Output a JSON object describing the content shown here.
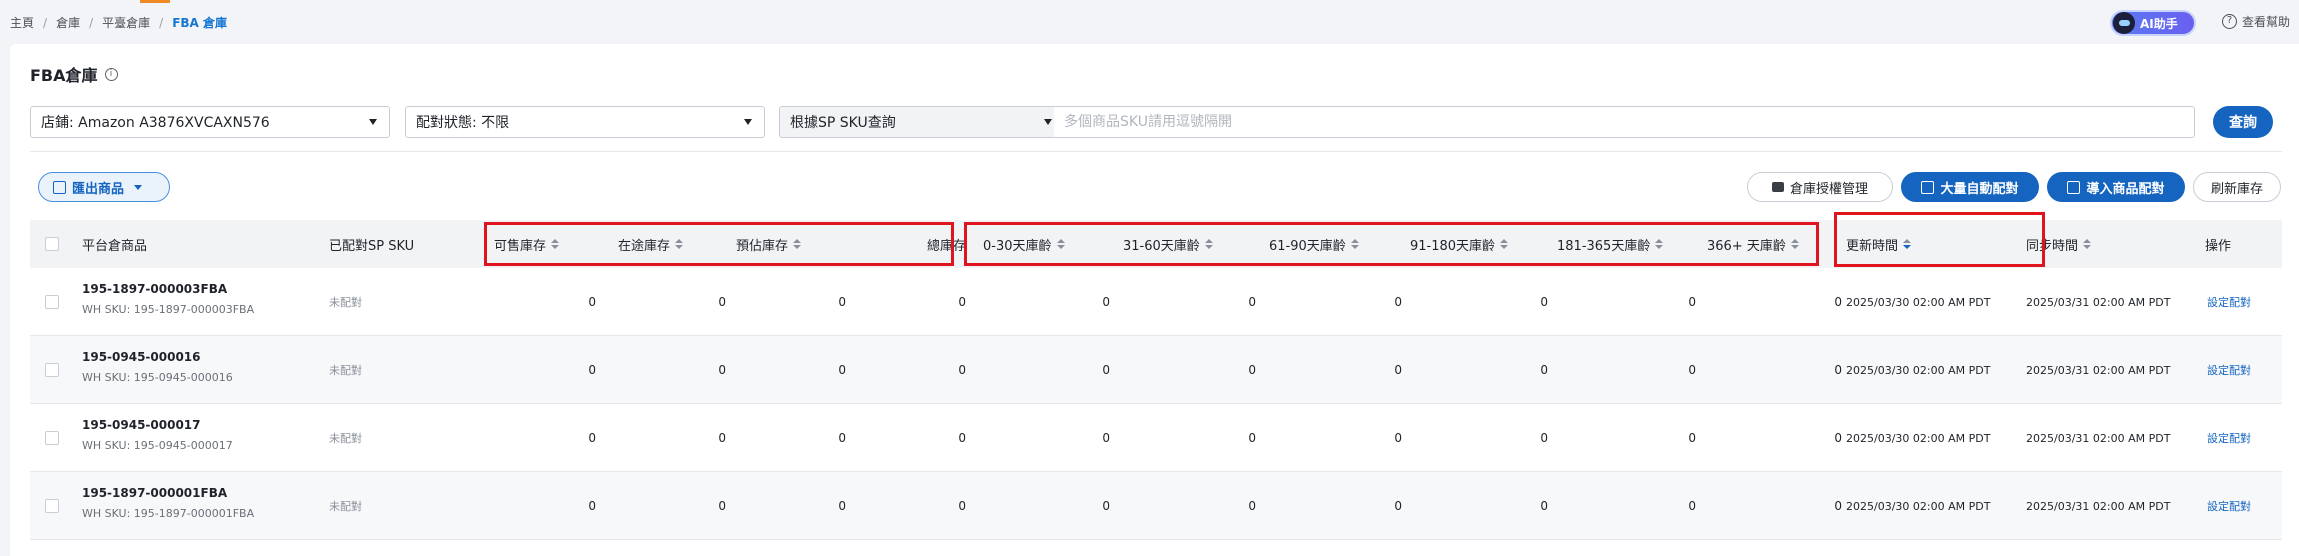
{
  "breadcrumb": [
    "主頁",
    "倉庫",
    "平臺倉庫",
    "FBA 倉庫"
  ],
  "header": {
    "ai_label": "AI助手",
    "help_label": "查看幫助"
  },
  "page": {
    "title": "FBA倉庫"
  },
  "filters": {
    "store": "店鋪: Amazon A3876XVCAXN576",
    "match_status": "配對狀態: 不限",
    "query_by": "根據SP SKU查詢",
    "search_placeholder": "多個商品SKU請用逗號隔開",
    "query_button": "查詢"
  },
  "toolbar": {
    "export": "匯出商品",
    "auth": "倉庫授權管理",
    "bulk_auto": "大量自動配對",
    "import": "導入商品配對",
    "refresh": "刷新庫存"
  },
  "columns": {
    "product": "平台倉商品",
    "matched_sku": "已配對SP SKU",
    "available": "可售庫存",
    "in_transit": "在途庫存",
    "reserved": "預佔庫存",
    "total": "總庫存",
    "age_0_30": "0-30天庫齡",
    "age_31_60": "31-60天庫齡",
    "age_61_90": "61-90天庫齡",
    "age_91_180": "91-180天庫齡",
    "age_181_365": "181-365天庫齡",
    "age_366": "366+ 天庫齡",
    "updated": "更新時間",
    "synced": "同步時間",
    "actions": "操作"
  },
  "rows": [
    {
      "name": "195-1897-000003FBA",
      "wh_sku": "WH SKU: 195-1897-000003FBA",
      "matched": "未配對",
      "available": "0",
      "in_transit": "0",
      "reserved": "0",
      "total": "0",
      "age_0_30": "0",
      "age_31_60": "0",
      "age_61_90": "0",
      "age_91_180": "0",
      "age_181_365": "0",
      "age_366": "0",
      "updated": "2025/03/30 02:00 AM PDT",
      "synced": "2025/03/31 02:00 AM PDT",
      "action": "設定配對"
    },
    {
      "name": "195-0945-000016",
      "wh_sku": "WH SKU: 195-0945-000016",
      "matched": "未配對",
      "available": "0",
      "in_transit": "0",
      "reserved": "0",
      "total": "0",
      "age_0_30": "0",
      "age_31_60": "0",
      "age_61_90": "0",
      "age_91_180": "0",
      "age_181_365": "0",
      "age_366": "0",
      "updated": "2025/03/30 02:00 AM PDT",
      "synced": "2025/03/31 02:00 AM PDT",
      "action": "設定配對"
    },
    {
      "name": "195-0945-000017",
      "wh_sku": "WH SKU: 195-0945-000017",
      "matched": "未配對",
      "available": "0",
      "in_transit": "0",
      "reserved": "0",
      "total": "0",
      "age_0_30": "0",
      "age_31_60": "0",
      "age_61_90": "0",
      "age_91_180": "0",
      "age_181_365": "0",
      "age_366": "0",
      "updated": "2025/03/30 02:00 AM PDT",
      "synced": "2025/03/31 02:00 AM PDT",
      "action": "設定配對"
    },
    {
      "name": "195-1897-000001FBA",
      "wh_sku": "WH SKU: 195-1897-000001FBA",
      "matched": "未配對",
      "available": "0",
      "in_transit": "0",
      "reserved": "0",
      "total": "0",
      "age_0_30": "0",
      "age_31_60": "0",
      "age_61_90": "0",
      "age_91_180": "0",
      "age_181_365": "0",
      "age_366": "0",
      "updated": "2025/03/30 02:00 AM PDT",
      "synced": "2025/03/31 02:00 AM PDT",
      "action": "設定配對"
    }
  ],
  "colors": {
    "primary": "#1565c0",
    "highlight": "#e0141e",
    "accent": "#f08a24"
  }
}
